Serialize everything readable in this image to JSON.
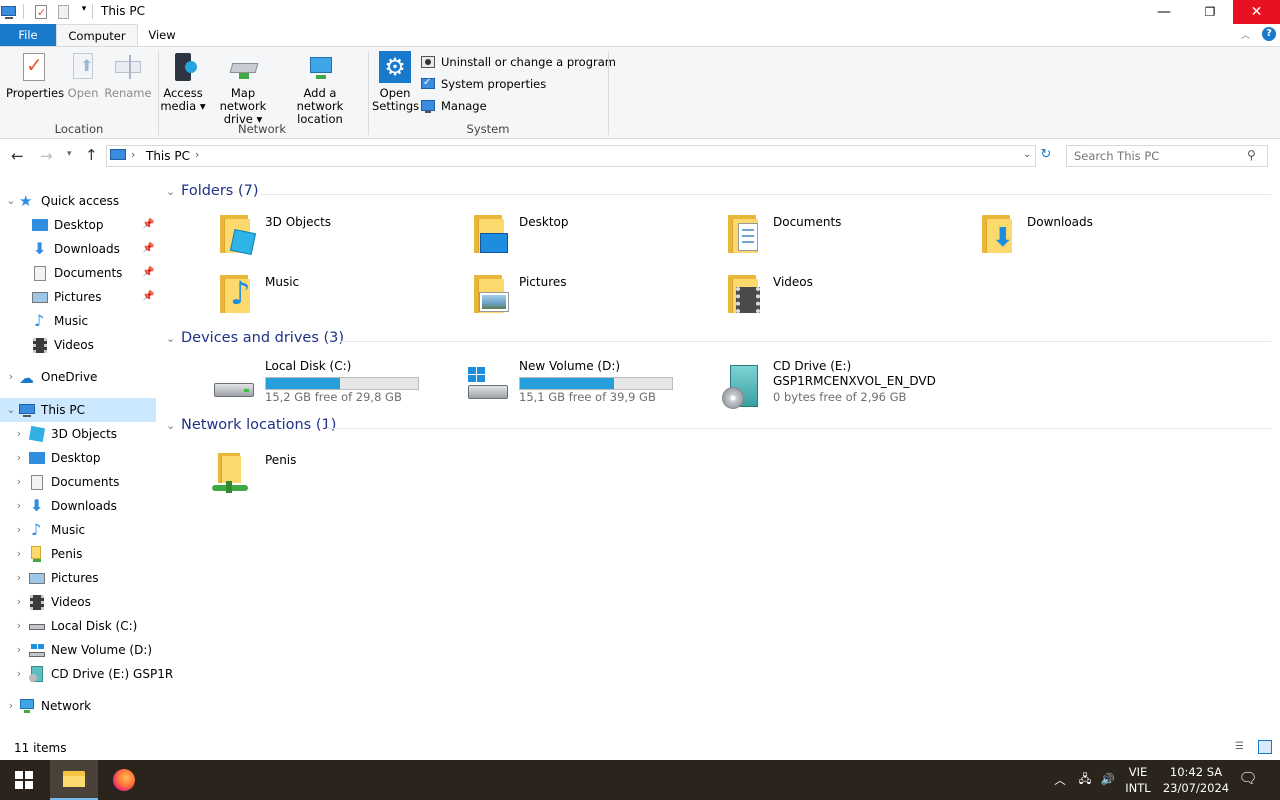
{
  "window": {
    "title": "This PC"
  },
  "ribbon_tabs": [
    "File",
    "Computer",
    "View"
  ],
  "ribbon": {
    "location": {
      "label": "Location",
      "properties": "Properties",
      "open": "Open",
      "rename": "Rename"
    },
    "network": {
      "label": "Network",
      "access_media": [
        "Access",
        "media"
      ],
      "map_drive": [
        "Map network",
        "drive"
      ],
      "add_location": [
        "Add a network",
        "location"
      ]
    },
    "system": {
      "label": "System",
      "open_settings": [
        "Open",
        "Settings"
      ],
      "uninstall": "Uninstall or change a program",
      "sys_props": "System properties",
      "manage": "Manage"
    }
  },
  "address": {
    "path": "This PC",
    "search_placeholder": "Search This PC"
  },
  "nav": {
    "quick_access": "Quick access",
    "quick_items": [
      "Desktop",
      "Downloads",
      "Documents",
      "Pictures",
      "Music",
      "Videos"
    ],
    "onedrive": "OneDrive",
    "this_pc": "This PC",
    "pc_items": [
      "3D Objects",
      "Desktop",
      "Documents",
      "Downloads",
      "Music",
      "Penis",
      "Pictures",
      "Videos",
      "Local Disk (C:)",
      "New Volume (D:)",
      "CD Drive (E:) GSP1R"
    ],
    "network": "Network"
  },
  "sections": {
    "folders": "Folders (7)",
    "drives": "Devices and drives (3)",
    "network": "Network locations (1)"
  },
  "folders": [
    "3D Objects",
    "Desktop",
    "Documents",
    "Downloads",
    "Music",
    "Pictures",
    "Videos"
  ],
  "drives": [
    {
      "name": "Local Disk (C:)",
      "free": "15,2 GB free of 29,8 GB",
      "used_fraction": 0.49
    },
    {
      "name": "New Volume (D:)",
      "free": "15,1 GB free of 39,9 GB",
      "used_fraction": 0.62
    },
    {
      "name": "CD Drive (E:)",
      "name2": "GSP1RMCENXVOL_EN_DVD",
      "free": "0 bytes free of 2,96 GB"
    }
  ],
  "network_locations": [
    "Penis"
  ],
  "status": {
    "items": "11 items"
  },
  "tray": {
    "lang1": "VIE",
    "lang2": "INTL",
    "time": "10:42 SA",
    "date": "23/07/2024"
  },
  "colors": {
    "accent": "#1979ca",
    "selection": "#cce8ff",
    "close": "#e81123",
    "bar": "#26a0da",
    "section": "#1e3287"
  }
}
